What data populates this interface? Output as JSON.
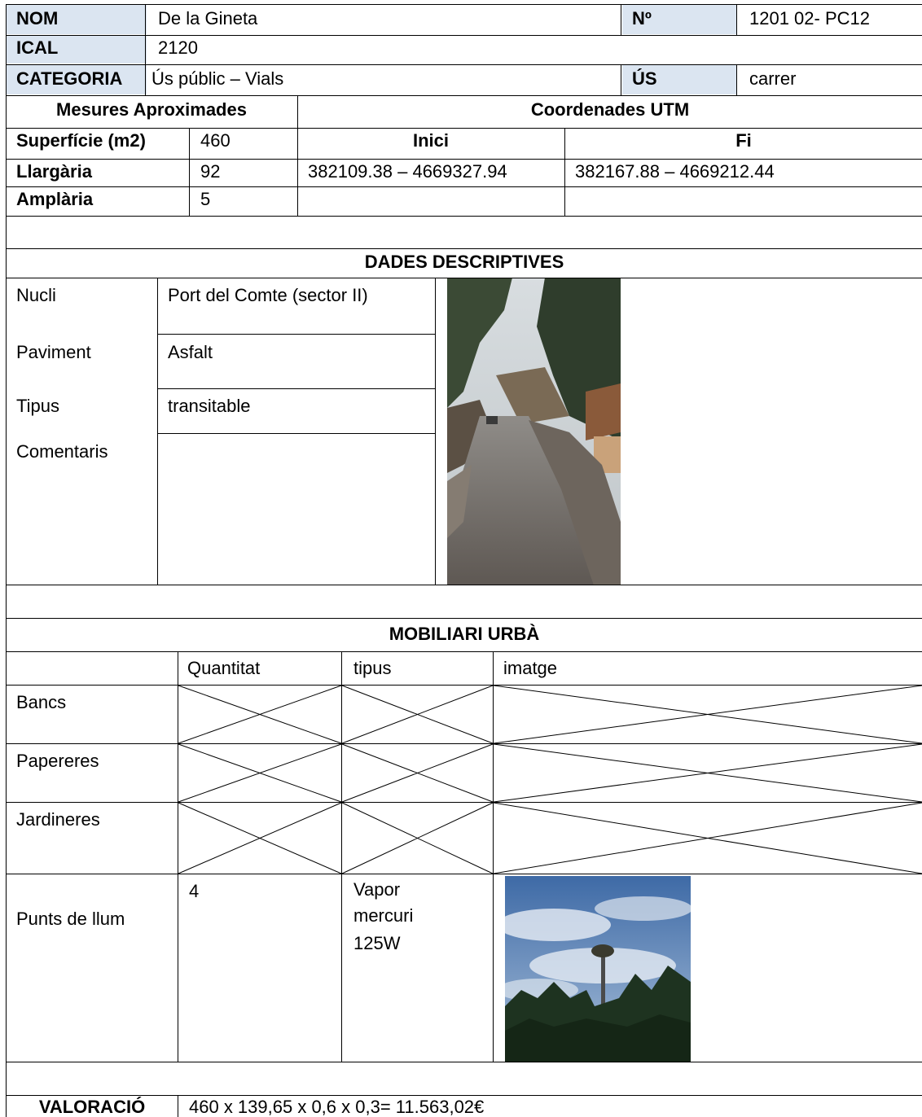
{
  "header": {
    "nom_label": "NOM",
    "nom_value": "De la Gineta",
    "num_label": "Nº",
    "num_value": "1201 02- PC12",
    "ical_label": "ICAL",
    "ical_value": "2120",
    "categoria_label": "CATEGORIA",
    "categoria_value": "Ús públic – Vials",
    "us_label": "ÚS",
    "us_value": "carrer"
  },
  "measures": {
    "title": "Mesures Aproximades",
    "coords_title": "Coordenades UTM",
    "inici_label": "Inici",
    "fi_label": "Fi",
    "rows": [
      {
        "label": "Superfície (m2)",
        "value": "460"
      },
      {
        "label": "Llargària",
        "value": "92",
        "inici": "382109.38 – 4669327.94",
        "fi": "382167.88 – 4669212.44"
      },
      {
        "label": "Amplària",
        "value": "5"
      }
    ]
  },
  "descriptive": {
    "title": "DADES DESCRIPTIVES",
    "rows": [
      {
        "label": "Nucli",
        "value": "Port del Comte (sector II)"
      },
      {
        "label": "Paviment",
        "value": "Asfalt"
      },
      {
        "label": "Tipus",
        "value": "transitable"
      },
      {
        "label": "Comentaris",
        "value": ""
      }
    ]
  },
  "furniture": {
    "title": "MOBILIARI URBÀ",
    "columns": [
      "Quantitat",
      "tipus",
      "imatge"
    ],
    "rows": [
      {
        "label": "Bancs"
      },
      {
        "label": "Papereres"
      },
      {
        "label": "Jardineres"
      },
      {
        "label": "Punts de llum",
        "quantity": "4",
        "type_lines": [
          "Vapor",
          "mercuri",
          "125W"
        ]
      }
    ]
  },
  "valuation": {
    "label": "VALORACIÓ",
    "value": "460 x 139,65 x 0,6 x 0,3= 11.563,02€"
  }
}
